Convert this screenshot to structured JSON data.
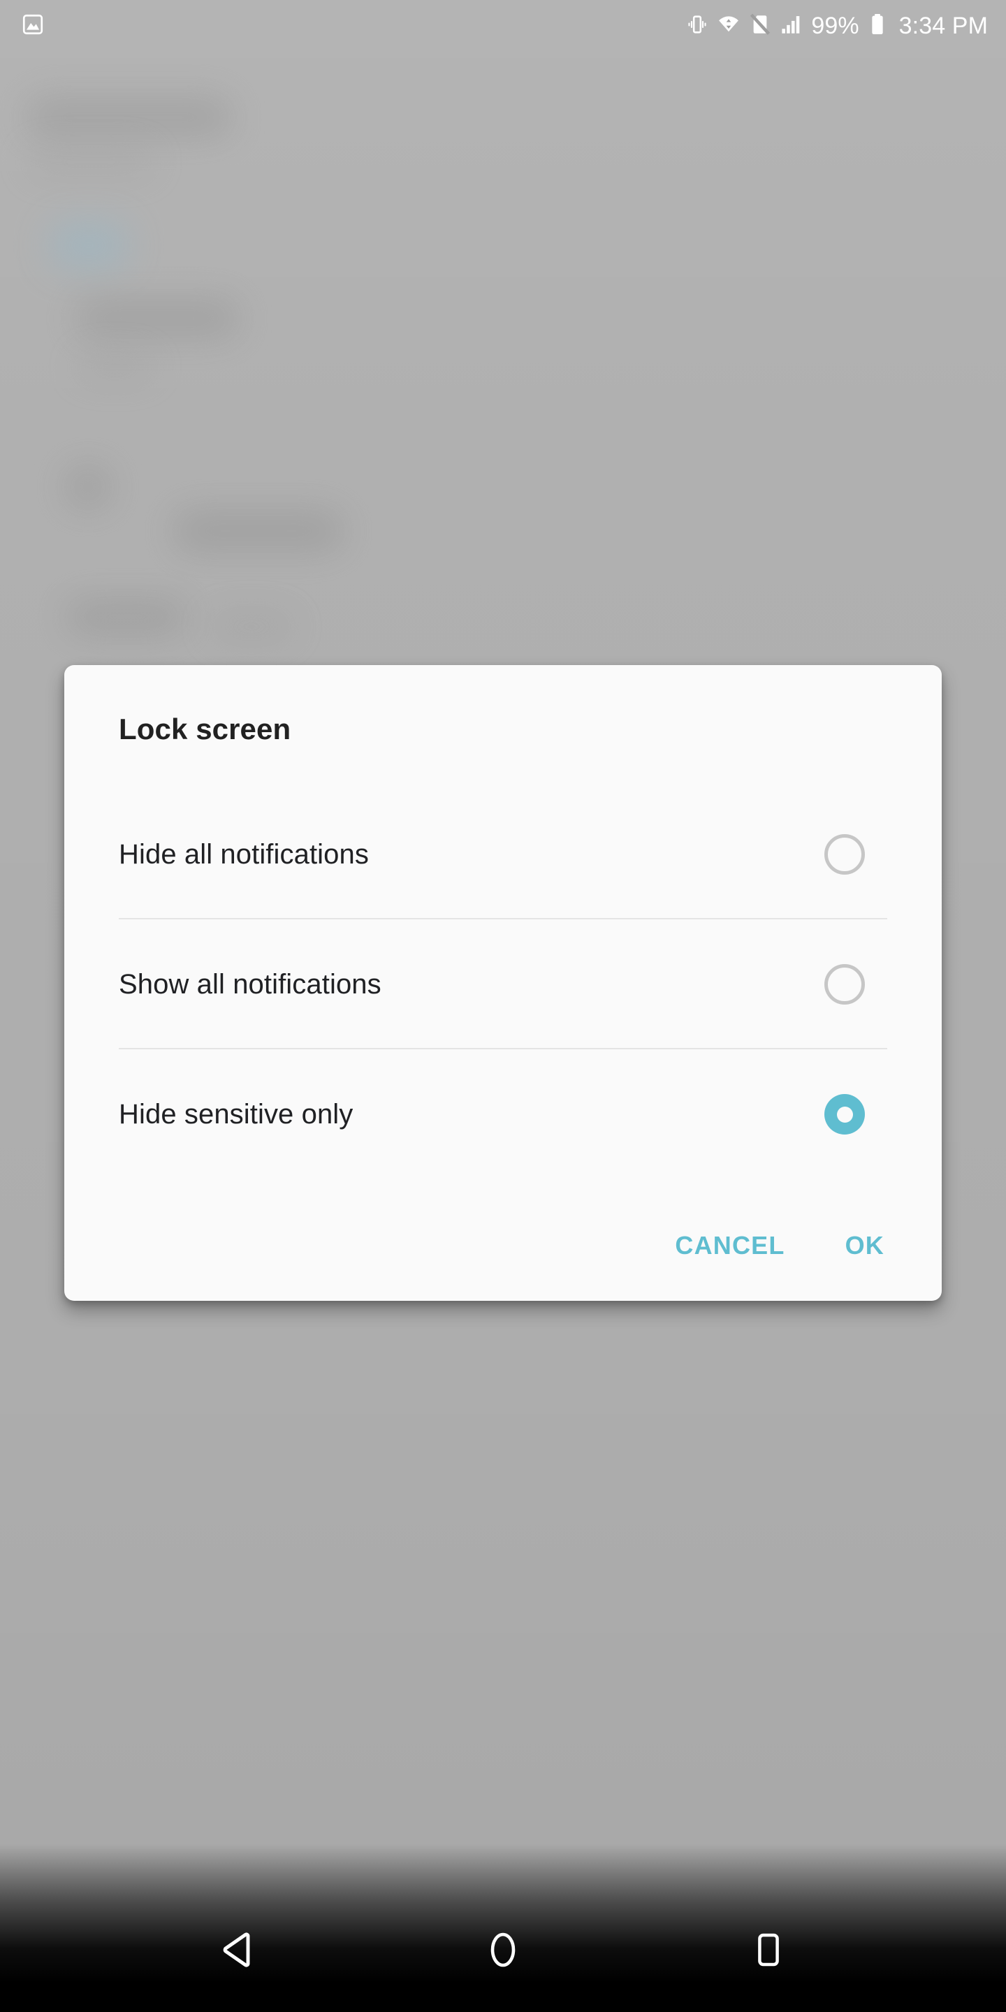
{
  "statusbar": {
    "notification_icon": "photo-icon",
    "icons": [
      "vibrate-icon",
      "wifi-icon",
      "no-sim-icon",
      "signal-bars-icon",
      "battery-icon"
    ],
    "battery_percent": "99%",
    "clock": "3:34 PM"
  },
  "dialog": {
    "title": "Lock screen",
    "options": [
      {
        "label": "Hide all notifications",
        "selected": false
      },
      {
        "label": "Show all notifications",
        "selected": false
      },
      {
        "label": "Hide sensitive only",
        "selected": true
      }
    ],
    "cancel_label": "CANCEL",
    "ok_label": "OK",
    "accent_color": "#5fbdd0",
    "surface_color": "#fafafa"
  },
  "navbar": {
    "back_label": "back-button",
    "home_label": "home-button",
    "recents_label": "recents-button"
  },
  "background": {
    "scrim_color": "#b0b0b0"
  }
}
